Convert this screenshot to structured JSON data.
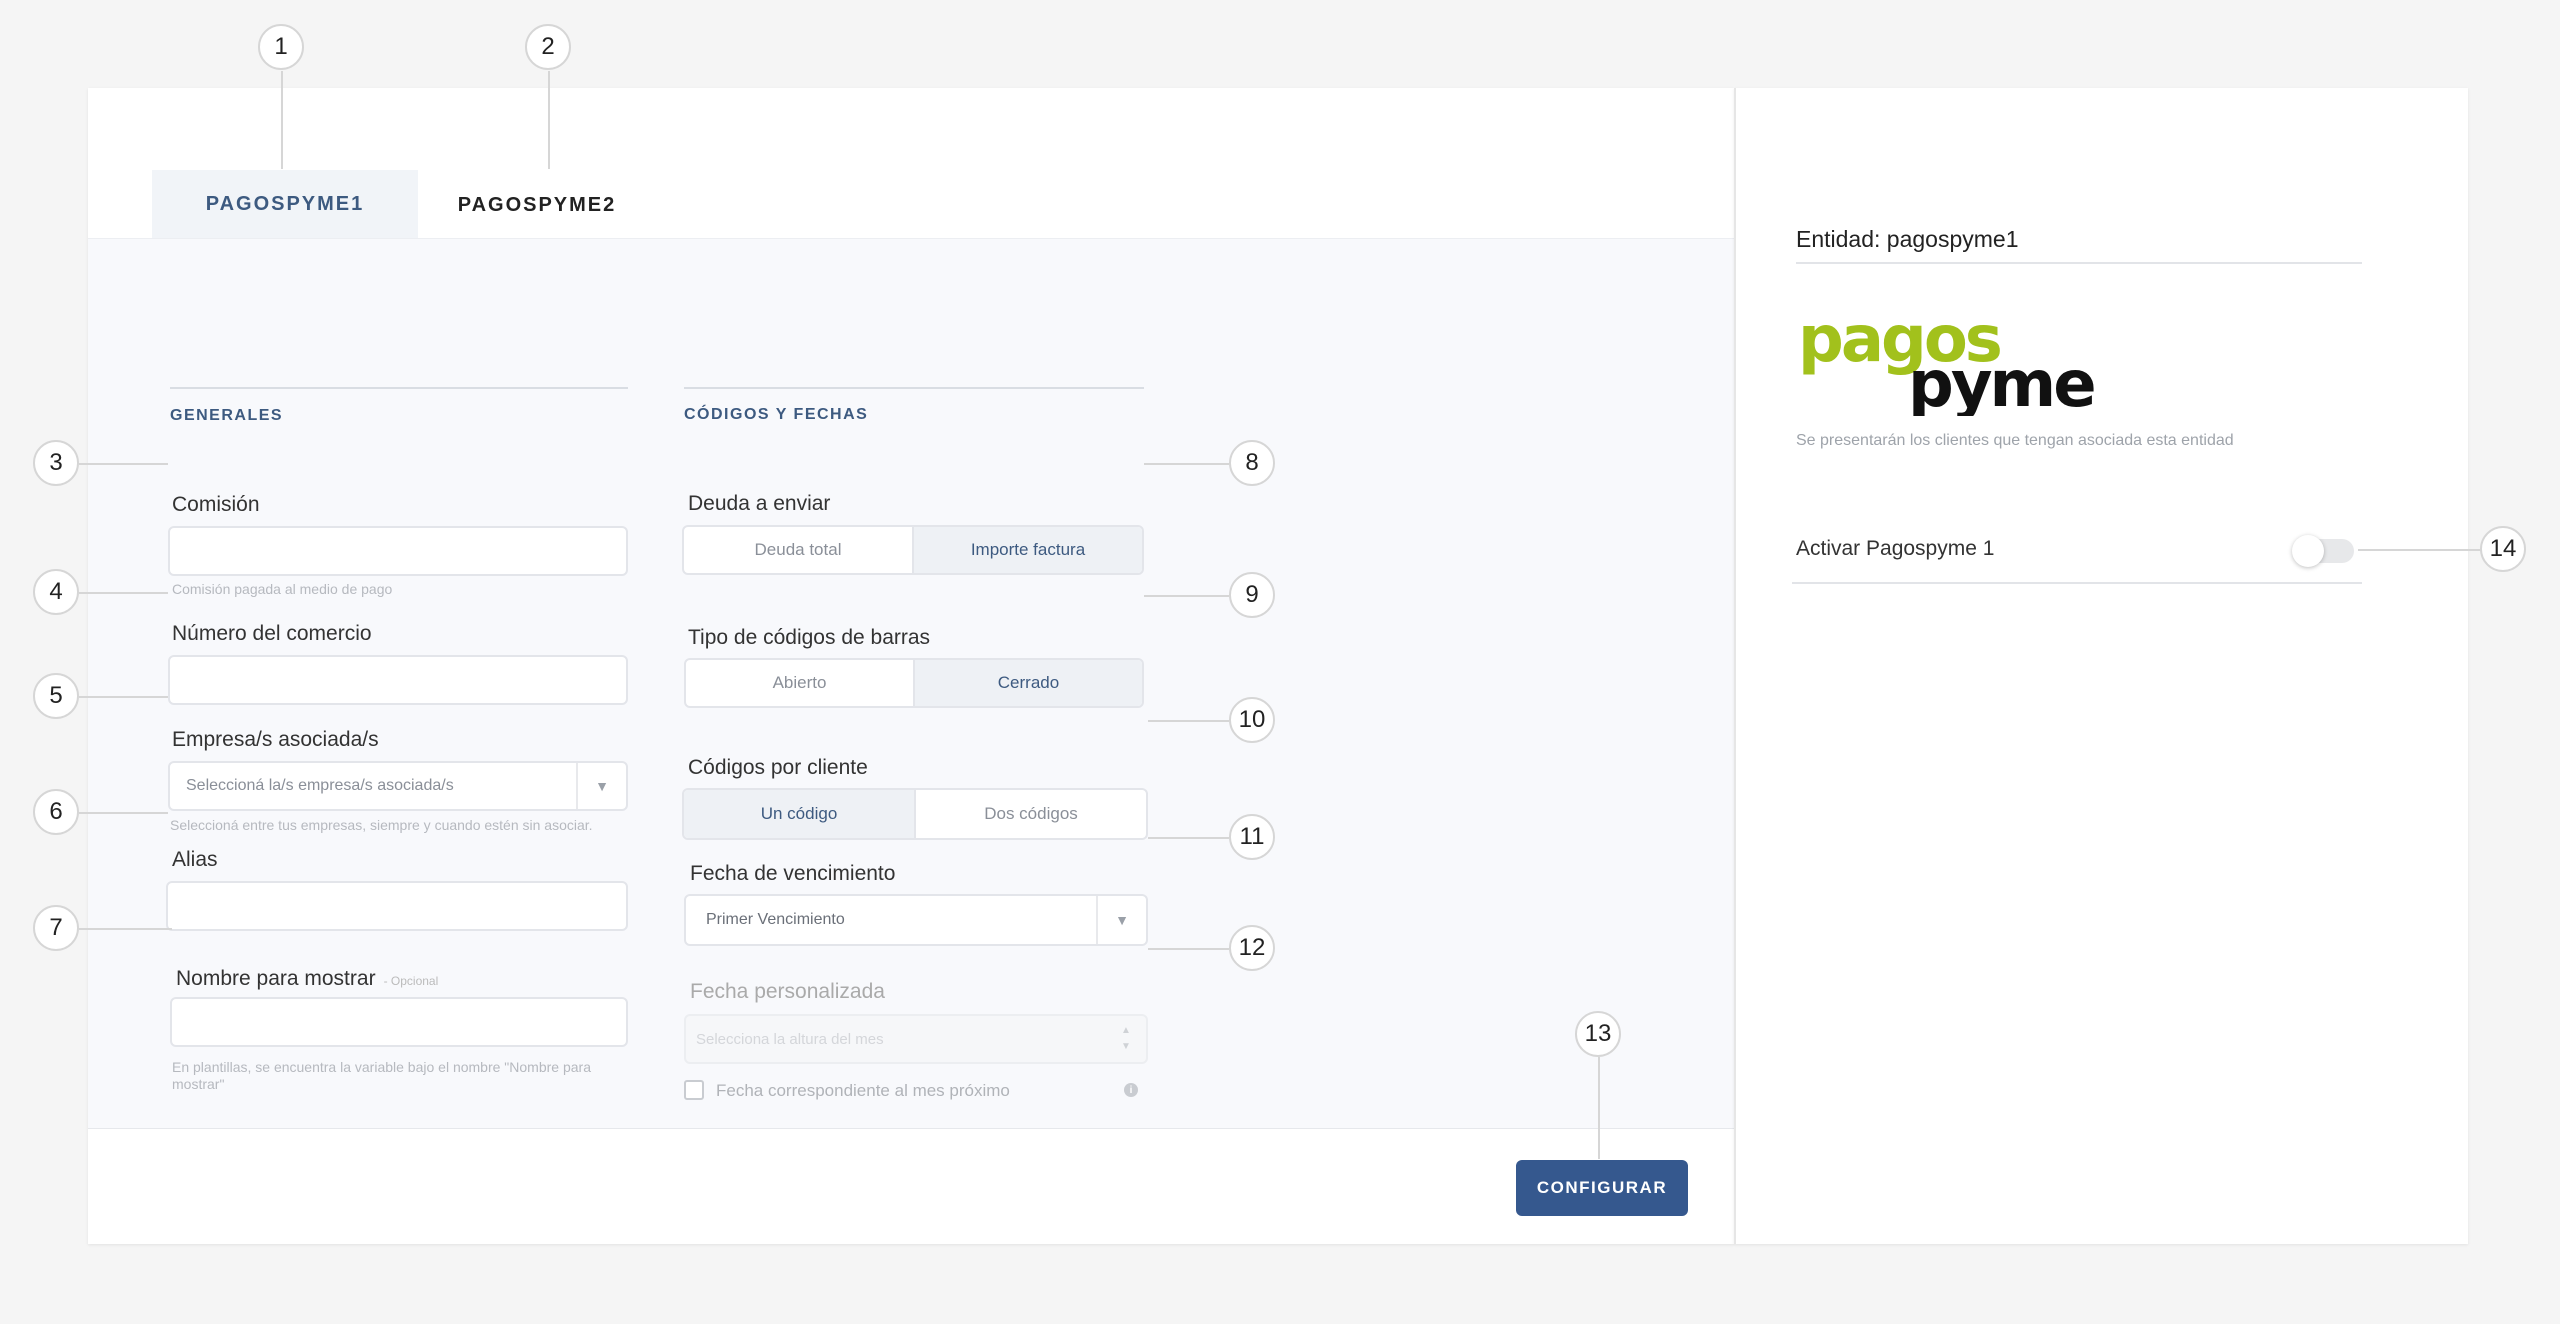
{
  "tabs": [
    {
      "label": "PAGOSPYME1",
      "active": true
    },
    {
      "label": "PAGOSPYME2",
      "active": false
    }
  ],
  "sections": {
    "generales": "GENERALES",
    "codigos": "CÓDIGOS Y FECHAS"
  },
  "fields": {
    "comision": {
      "label": "Comisión",
      "help": "Comisión pagada al medio de pago",
      "value": ""
    },
    "numero_comercio": {
      "label": "Número del comercio",
      "value": ""
    },
    "empresas": {
      "label": "Empresa/s asociada/s",
      "placeholder": "Seleccioná la/s empresa/s asociada/s",
      "help": "Seleccioná entre tus empresas, siempre y cuando estén sin asociar."
    },
    "alias": {
      "label": "Alias",
      "value": ""
    },
    "nombre_mostrar": {
      "label": "Nombre para mostrar",
      "optional": "- Opcional",
      "help_line1": "En plantillas, se encuentra la variable bajo el nombre \"Nombre para",
      "help_line2": "mostrar\"",
      "value": ""
    }
  },
  "codigos": {
    "deuda": {
      "label": "Deuda a enviar",
      "options": [
        "Deuda total",
        "Importe factura"
      ],
      "selected": "Importe factura"
    },
    "tipo_barras": {
      "label": "Tipo de códigos de barras",
      "options": [
        "Abierto",
        "Cerrado"
      ],
      "selected": "Cerrado"
    },
    "codigos_cliente": {
      "label": "Códigos por cliente",
      "options": [
        "Un código",
        "Dos códigos"
      ],
      "selected": "Un código"
    },
    "fecha_venc": {
      "label": "Fecha de vencimiento",
      "value": "Primer Vencimiento"
    },
    "fecha_pers": {
      "label": "Fecha personalizada",
      "placeholder": "Selecciona la altura del mes"
    },
    "mes_proximo": {
      "label": "Fecha correspondiente al mes próximo",
      "checked": false
    }
  },
  "footer": {
    "configurar": "CONFIGURAR"
  },
  "entity": {
    "title": "Entidad: pagospyme1",
    "logo_top": "pagos",
    "logo_bottom": "pyme",
    "description": "Se presentarán los clientes que tengan asociada esta entidad",
    "toggle_label": "Activar Pagospyme 1",
    "toggle_on": false
  },
  "callouts": [
    "1",
    "2",
    "3",
    "4",
    "5",
    "6",
    "7",
    "8",
    "9",
    "10",
    "11",
    "12",
    "13",
    "14"
  ],
  "colors": {
    "accent": "#3d5a80",
    "button": "#35588e",
    "logo_green": "#a2c11c",
    "logo_black": "#111111"
  }
}
